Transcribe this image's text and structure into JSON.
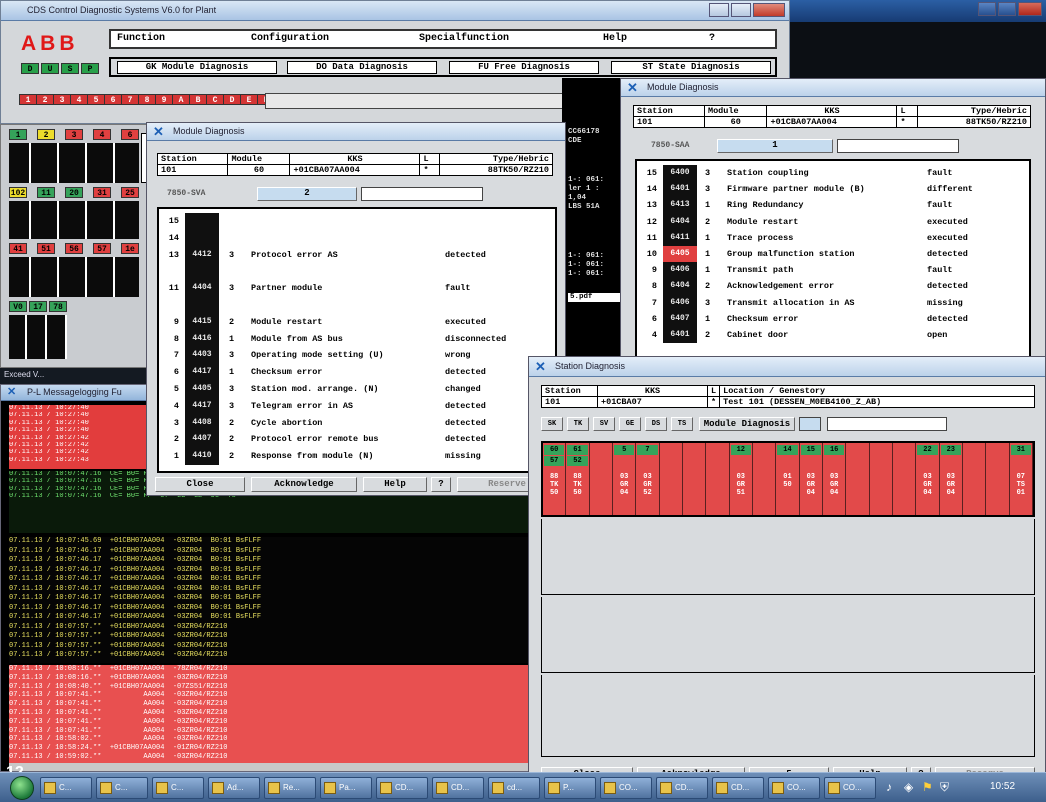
{
  "main": {
    "title": "CDS Control Diagnostic Systems V6.0  for Plant",
    "logo": "ABB",
    "menu": [
      "Function",
      "Configuration",
      "Specialfunction",
      "Help",
      "?"
    ],
    "diag_buttons": [
      "GK Module Diagnosis",
      "DO Data Diagnosis",
      "FU Free Diagnosis",
      "ST State Diagnosis"
    ],
    "small_keys": [
      "D",
      "U",
      "S",
      "P"
    ],
    "station_keys": [
      "1",
      "2",
      "3",
      "4",
      "5",
      "6",
      "7",
      "8",
      "9",
      "A",
      "B",
      "C",
      "D",
      "E",
      "F"
    ]
  },
  "rack": {
    "top_labels": [
      "1",
      "2",
      "3",
      "4",
      "6"
    ],
    "row2_labels": [
      "102",
      "11",
      "20",
      "31",
      "25"
    ],
    "row3_labels": [
      "41",
      "51",
      "56",
      "57",
      "1e"
    ],
    "row4_labels": [
      "V0",
      "17",
      "78"
    ],
    "side_label": "Exceed V..."
  },
  "log": {
    "title": "P-L Messagelogging Fu",
    "red_rows_top": [
      "07.11.13 / 10:27:40",
      "07.11.13 / 10:27:40",
      "07.11.13 / 10:27:40",
      "07.11.13 / 10:27:40",
      "07.11.13 / 10:27:42",
      "07.11.13 / 10:27:42",
      "07.11.13 / 10:27:42",
      "07.11.13 / 10:27:43"
    ],
    "green_rows": [
      "07.11.13 / 10:07:47.16  CE= B0= FP= 57= LS  GE  U3  T8",
      "07.11.13 / 10:07:47.16  CE= B0= FP= 57= LS  GE  U3  T8",
      "07.11.13 / 10:07:47.16  CE= B0= FP= 57= LS  GE  U3  T8",
      "07.11.13 / 10:07:47.16  CE= B0= FP= 57= LS  GE  U3  T8"
    ],
    "yellow_rows": [
      "07.11.13 / 10:07:45.69  +01CBH07AA004  -03ZR04  B0:01 BsFLFF",
      "07.11.13 / 10:07:46.17  +01CBH07AA004  -03ZR04  B0:01 BsFLFF",
      "07.11.13 / 10:07:46.17  +01CBH07AA004  -03ZR04  B0:01 BsFLFF",
      "07.11.13 / 10:07:46.17  +01CBH07AA004  -03ZR04  B0:01 BsFLFF",
      "07.11.13 / 10:07:46.17  +01CBH07AA004  -03ZR04  B0:01 BsFLFF",
      "07.11.13 / 10:07:46.17  +01CBH07AA004  -03ZR04  B0:01 BsFLFF",
      "07.11.13 / 10:07:46.17  +01CBH07AA004  -03ZR04  B0:01 BsFLFF",
      "07.11.13 / 10:07:46.17  +01CBH07AA004  -03ZR04  B0:01 BsFLFF",
      "07.11.13 / 10:07:46.17  +01CBH07AA004  -03ZR04  B0:01 BsFLFF",
      "07.11.13 / 10:07:57.**  +01CBH07AA004  -03ZR04/RZ210",
      "07.11.13 / 10:07:57.**  +01CBH07AA004  -03ZR04/RZ210",
      "07.11.13 / 10:07:57.**  +01CBH07AA004  -03ZR04/RZ210",
      "07.11.13 / 10:07:57.**  +01CBH07AA004  -03ZR04/RZ210"
    ],
    "red_rows_bottom": [
      "07.11.13 / 10:08:16.**  +01CBH07AA004  -78ZR04/RZ210",
      "07.11.13 / 10:08:16.**  +01CBH07AA004  -03ZR04/RZ210",
      "07.11.13 / 10:08:40.**  +01CBH07AA004  -07ZS51/RZ210",
      "07.11.13 / 10:07:41.**          AA004  -03ZR04/RZ210",
      "07.11.13 / 10:07:41.**          AA004  -03ZR04/RZ210",
      "07.11.13 / 10:07:41.**          AA004  -03ZR04/RZ210",
      "07.11.13 / 10:07:41.**          AA004  -03ZR04/RZ210",
      "07.11.13 / 10:07:41.**          AA004  -03ZR04/RZ210",
      "07.11.13 / 10:58:02.**          AA004  -03ZR04/RZ210",
      "07.11.13 / 10:58:24.**  +01CBH07AA004  -01ZR04/RZ210",
      "07.11.13 / 10:59:02.**          AA004  -03ZR04/RZ210"
    ],
    "page_num": "12"
  },
  "md1": {
    "title": "Module Diagnosis",
    "headers": [
      "Station",
      "Module",
      "KKS",
      "L",
      "Type/Hebric"
    ],
    "values": [
      "101",
      "60",
      "+01CBA07AA004",
      "*",
      "88TK50/RZ210"
    ],
    "sub_label": "7850-SVA",
    "sub_value": "2",
    "rows": [
      {
        "num": "15",
        "code": "",
        "cnt": "",
        "text": "",
        "status": ""
      },
      {
        "num": "14",
        "code": "",
        "cnt": "",
        "text": "",
        "status": ""
      },
      {
        "num": "13",
        "code": "4412",
        "cnt": "3",
        "text": "Protocol error AS",
        "status": "detected"
      },
      {
        "num": "",
        "code": "",
        "cnt": "",
        "text": "",
        "status": ""
      },
      {
        "num": "11",
        "code": "4404",
        "cnt": "3",
        "text": "Partner module",
        "status": "fault"
      },
      {
        "num": "",
        "code": "",
        "cnt": "",
        "text": "",
        "status": ""
      },
      {
        "num": "9",
        "code": "4415",
        "cnt": "2",
        "text": "Module restart",
        "status": "executed"
      },
      {
        "num": "8",
        "code": "4416",
        "cnt": "1",
        "text": "Module from AS bus",
        "status": "disconnected"
      },
      {
        "num": "7",
        "code": "4403",
        "cnt": "3",
        "text": "Operating mode setting  (U)",
        "status": "wrong"
      },
      {
        "num": "6",
        "code": "4417",
        "cnt": "1",
        "text": "Checksum error",
        "status": "detected"
      },
      {
        "num": "5",
        "code": "4405",
        "cnt": "3",
        "text": "Station mod. arrange.  (N)",
        "status": "changed"
      },
      {
        "num": "4",
        "code": "4417",
        "cnt": "3",
        "text": "Telegram error in AS",
        "status": "detected"
      },
      {
        "num": "3",
        "code": "4408",
        "cnt": "2",
        "text": "Cycle abortion",
        "status": "detected"
      },
      {
        "num": "2",
        "code": "4407",
        "cnt": "2",
        "text": "Protocol error remote bus",
        "status": "detected"
      },
      {
        "num": "1",
        "code": "4410",
        "cnt": "2",
        "text": "Response from module   (N)",
        "status": "missing"
      }
    ],
    "buttons": [
      "Close",
      "Acknowledge",
      "Help",
      "?",
      "Reserve"
    ]
  },
  "md2": {
    "title": "Module Diagnosis",
    "headers": [
      "Station",
      "Module",
      "KKS",
      "L",
      "Type/Hebric"
    ],
    "values": [
      "101",
      "60",
      "+01CBA07AA004",
      "*",
      "88TK50/RZ210"
    ],
    "sub_label": "7850-SAA",
    "sub_value": "1",
    "rows": [
      {
        "num": "15",
        "code": "6400",
        "cnt": "3",
        "text": "Station coupling",
        "status": "fault",
        "red": false
      },
      {
        "num": "14",
        "code": "6401",
        "cnt": "3",
        "text": "Firmware partner module (B)",
        "status": "different",
        "red": false
      },
      {
        "num": "13",
        "code": "6413",
        "cnt": "1",
        "text": "Ring Redundancy",
        "status": "fault",
        "red": false
      },
      {
        "num": "12",
        "code": "6404",
        "cnt": "2",
        "text": "Module restart",
        "status": "executed",
        "red": false
      },
      {
        "num": "11",
        "code": "6411",
        "cnt": "1",
        "text": "Trace process",
        "status": "executed",
        "red": false
      },
      {
        "num": "10",
        "code": "6405",
        "cnt": "1",
        "text": "Group malfunction station",
        "status": "detected",
        "red": true
      },
      {
        "num": "9",
        "code": "6406",
        "cnt": "1",
        "text": "Transmit path",
        "status": "fault",
        "red": false
      },
      {
        "num": "8",
        "code": "6404",
        "cnt": "2",
        "text": "Acknowledgement error",
        "status": "detected",
        "red": false
      },
      {
        "num": "7",
        "code": "6406",
        "cnt": "3",
        "text": "Transmit allocation in AS",
        "status": "missing",
        "red": false
      },
      {
        "num": "6",
        "code": "6407",
        "cnt": "1",
        "text": "Checksum error",
        "status": "detected",
        "red": false
      },
      {
        "num": "4",
        "code": "6401",
        "cnt": "2",
        "text": "Cabinet door",
        "status": "open",
        "red": false
      }
    ],
    "peek_text": [
      "CC66178",
      "CDE",
      "1-: 061:",
      "ler 1  :",
      "1,04",
      "LBS 51A",
      "1-: 061:",
      "1-: 061:",
      "1-: 061:",
      "5.pdf"
    ]
  },
  "sd": {
    "title": "Station Diagnosis",
    "headers": [
      "Station",
      "KKS",
      "L",
      "Location / Genestory"
    ],
    "values": [
      "101",
      "+01CBA07",
      "*",
      "Test 101 (DESSEN_M0EB4100_Z_AB)"
    ],
    "tabs": [
      "SK",
      "TK",
      "SV",
      "GE",
      "DS",
      "TS"
    ],
    "module_diag_button": "Module Diagnosis",
    "slots": [
      {
        "top": "60",
        "mid": "57",
        "bot": "88\nTK\n50"
      },
      {
        "top": "61",
        "mid": "52",
        "bot": "88\nTK\n50"
      },
      {
        "top": "",
        "mid": "",
        "bot": ""
      },
      {
        "top": "5",
        "mid": "",
        "bot": "03\nGR\n04"
      },
      {
        "top": "7",
        "mid": "",
        "bot": "03\nGR\n52"
      },
      {
        "top": "",
        "mid": "",
        "bot": ""
      },
      {
        "top": "",
        "mid": "",
        "bot": ""
      },
      {
        "top": "",
        "mid": "",
        "bot": ""
      },
      {
        "top": "12",
        "mid": "",
        "bot": "03\nGR\n51"
      },
      {
        "top": "",
        "mid": "",
        "bot": ""
      },
      {
        "top": "14",
        "mid": "",
        "bot": "01\n50"
      },
      {
        "top": "15",
        "mid": "",
        "bot": "03\nGR\n04"
      },
      {
        "top": "16",
        "mid": "",
        "bot": "03\nGR\n04"
      },
      {
        "top": "",
        "mid": "",
        "bot": ""
      },
      {
        "top": "",
        "mid": "",
        "bot": ""
      },
      {
        "top": "",
        "mid": "",
        "bot": ""
      },
      {
        "top": "22",
        "mid": "",
        "bot": "03\nGR\n04"
      },
      {
        "top": "23",
        "mid": "",
        "bot": "03\nGR\n04"
      },
      {
        "top": "",
        "mid": "",
        "bot": ""
      },
      {
        "top": "",
        "mid": "",
        "bot": ""
      },
      {
        "top": "31",
        "mid": "",
        "bot": "07\nTS\n01"
      }
    ],
    "buttons": [
      "Close",
      "Acknowledge",
      "5",
      "Help",
      "?",
      "Reserve"
    ]
  },
  "taskbar": {
    "items": [
      "C...",
      "C...",
      "C...",
      "Ad...",
      "Re...",
      "Pa...",
      "CD...",
      "CD...",
      "cd...",
      "P...",
      "CO...",
      "CD...",
      "CD...",
      "CO...",
      "CO..."
    ],
    "clock": "10:52"
  },
  "colors": {
    "panel_gray": "#d8dbde",
    "alarm_red": "#e64747",
    "ok_green": "#37a35a",
    "log_yellow": "#d8d24a",
    "title_blue": "#1c5fb5"
  }
}
